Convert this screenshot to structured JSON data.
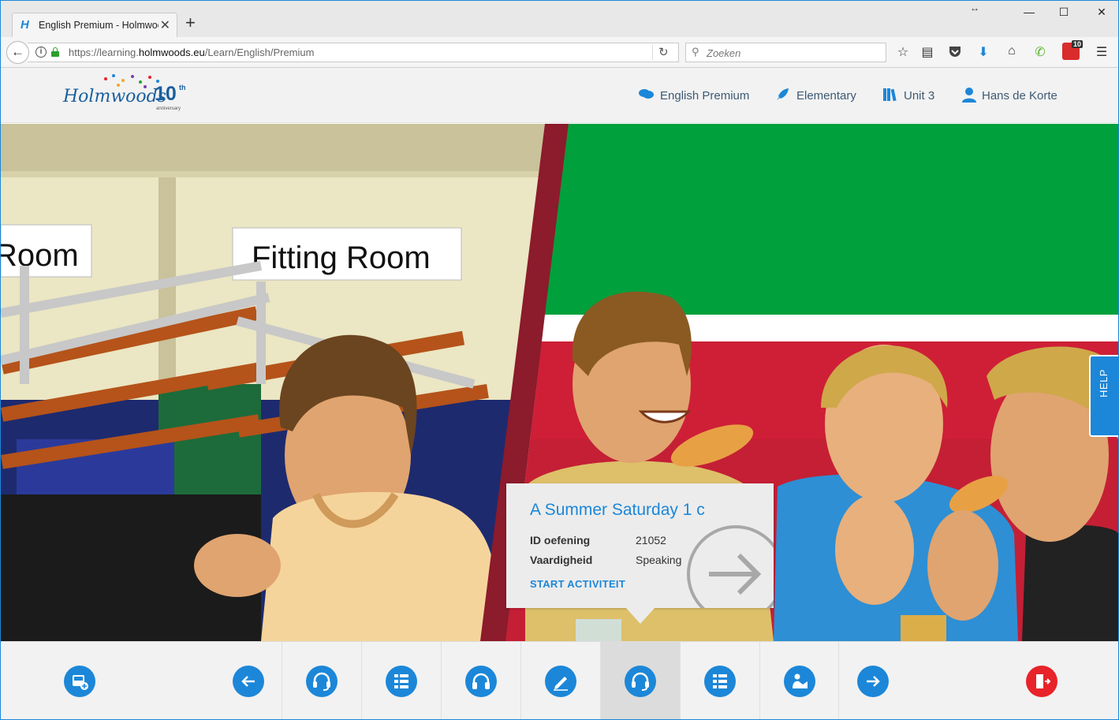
{
  "browser": {
    "tab_title": "English Premium - Holmwoods",
    "tab_favicon": "H",
    "new_tab_label": "+",
    "url_prefix": "https://learning.",
    "url_domain": "holmwoods.eu",
    "url_path": "/Learn/English/Premium",
    "search_placeholder": "Zoeken",
    "addon_badge_count": "10"
  },
  "logo": {
    "wordmark": "Holmwoods",
    "anniversary_number": "10",
    "anniversary_suffix": "th",
    "anniversary_label": "anniversary"
  },
  "header_nav": [
    {
      "label": "English Premium",
      "icon": "chat-bubbles-icon"
    },
    {
      "label": "Elementary",
      "icon": "rocket-icon"
    },
    {
      "label": "Unit 3",
      "icon": "books-icon"
    },
    {
      "label": "Hans de Korte",
      "icon": "user-icon"
    }
  ],
  "scene": {
    "sign_left": "Room",
    "sign_right": "Fitting Room"
  },
  "help_label": "HELP",
  "activity_card": {
    "title": "A Summer Saturday 1 c",
    "rows": [
      {
        "label": "ID oefening",
        "value": "21052"
      },
      {
        "label": "Vaardigheid",
        "value": "Speaking"
      }
    ],
    "action_label": "START ACTIVITEIT"
  },
  "toolbar": {
    "buttons": [
      {
        "icon": "bus-add-icon",
        "color": "#1c87d8"
      },
      {
        "icon": "arrow-left-icon",
        "color": "#1c87d8"
      },
      {
        "icon": "headset-icon",
        "color": "#1c87d8"
      },
      {
        "icon": "grid-list-icon",
        "color": "#1c87d8"
      },
      {
        "icon": "headphones-icon",
        "color": "#1c87d8"
      },
      {
        "icon": "pencil-icon",
        "color": "#1c87d8"
      },
      {
        "icon": "headset-icon",
        "color": "#1c87d8",
        "active": true
      },
      {
        "icon": "grid-list-icon",
        "color": "#1c87d8"
      },
      {
        "icon": "reading-person-icon",
        "color": "#1c87d8"
      },
      {
        "icon": "arrow-right-icon",
        "color": "#1c87d8"
      },
      {
        "icon": "exit-door-icon",
        "color": "#e8232a"
      }
    ]
  },
  "colors": {
    "accent": "#1c87d8",
    "exit": "#e8232a",
    "header_text": "#3e5a73"
  }
}
